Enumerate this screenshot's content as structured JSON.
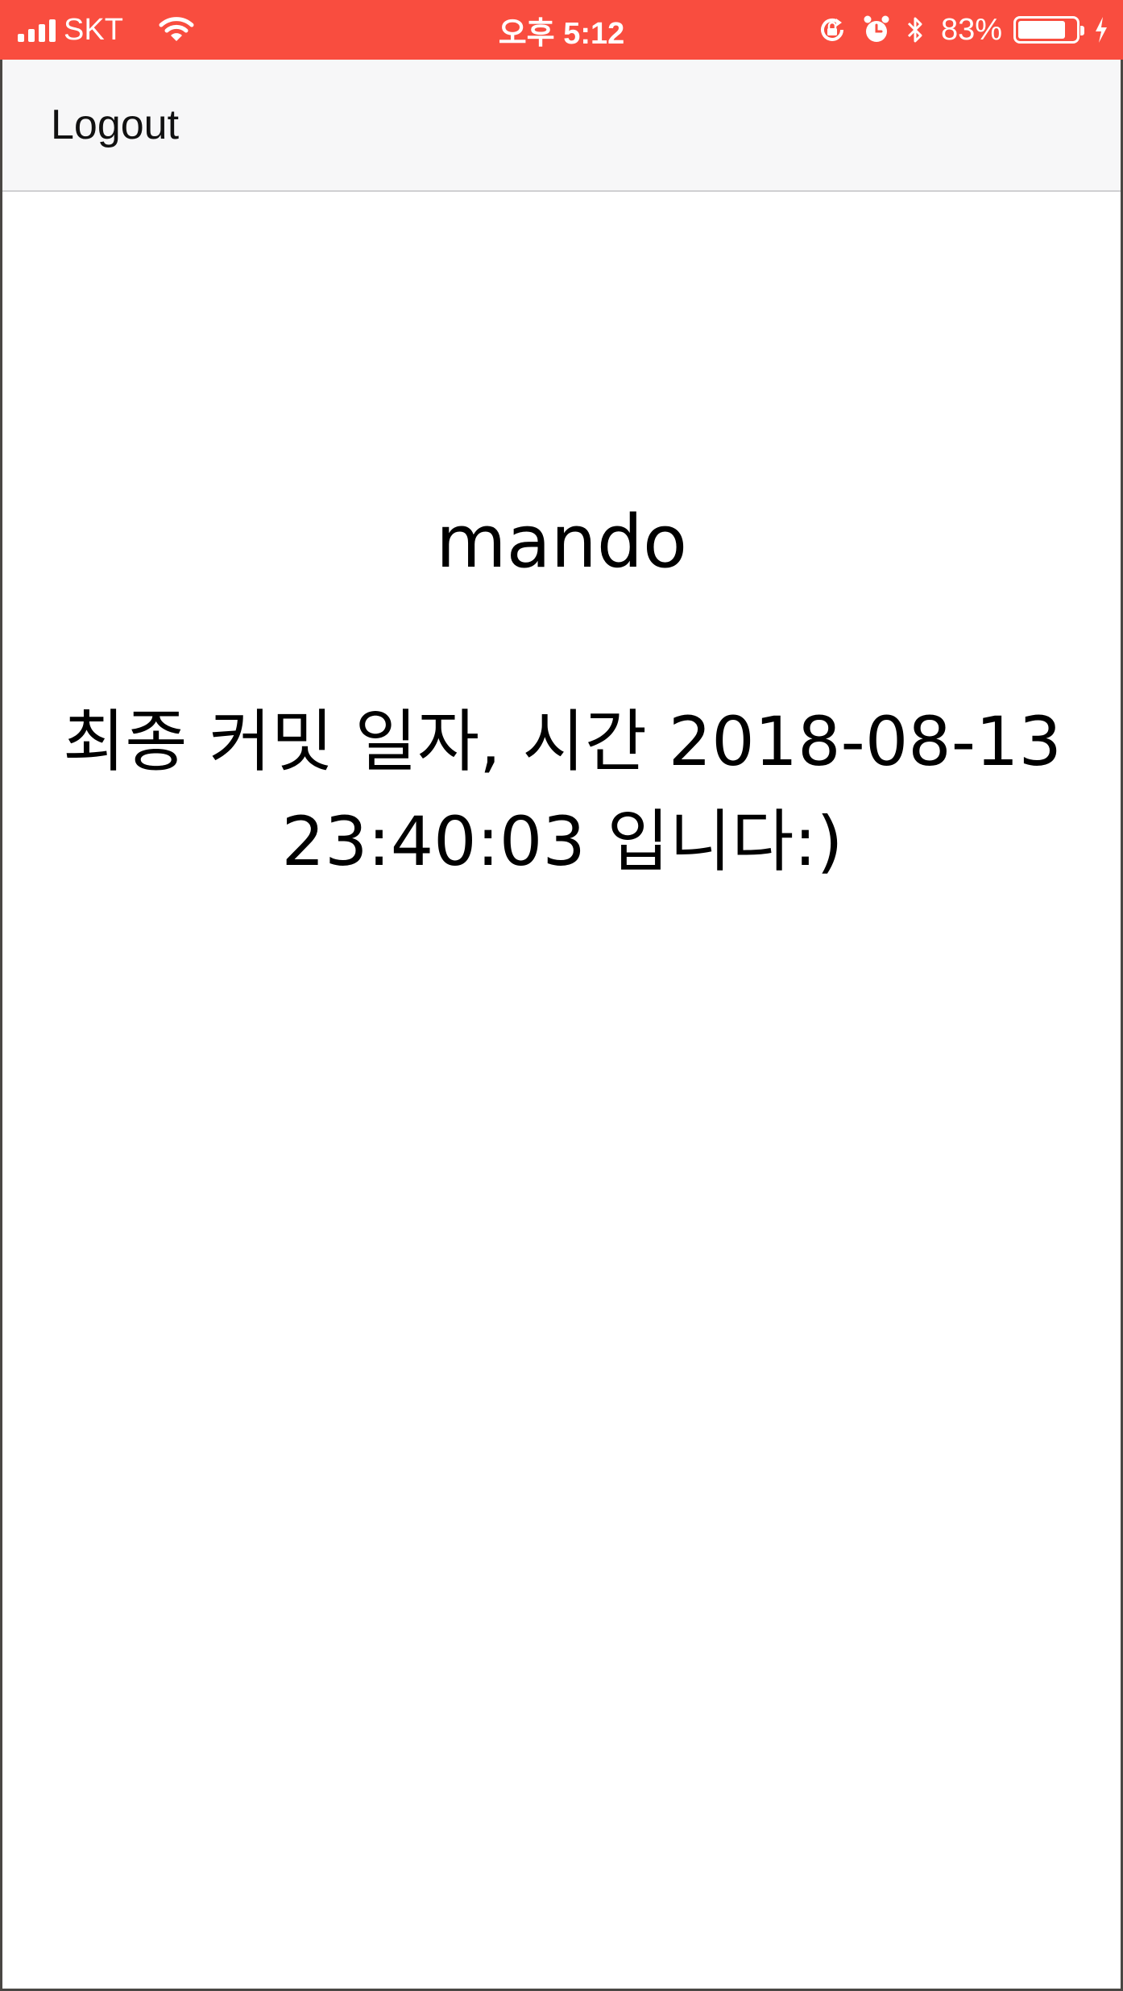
{
  "status_bar": {
    "carrier": "SKT",
    "time": "오후 5:12",
    "battery_percent": "83%",
    "battery_level": 0.83,
    "icons": [
      "signal-icon",
      "wifi-icon",
      "orientation-lock-icon",
      "alarm-icon",
      "bluetooth-icon",
      "battery-icon",
      "charging-icon"
    ]
  },
  "nav": {
    "logout_label": "Logout"
  },
  "content": {
    "username": "mando",
    "commit_message": "최종 커밋 일자, 시간 2018-08-13 23:40:03 입니다:)"
  },
  "colors": {
    "status_bar": "#f94d3f",
    "nav_bar": "#f7f7f8",
    "background": "#ffffff"
  }
}
